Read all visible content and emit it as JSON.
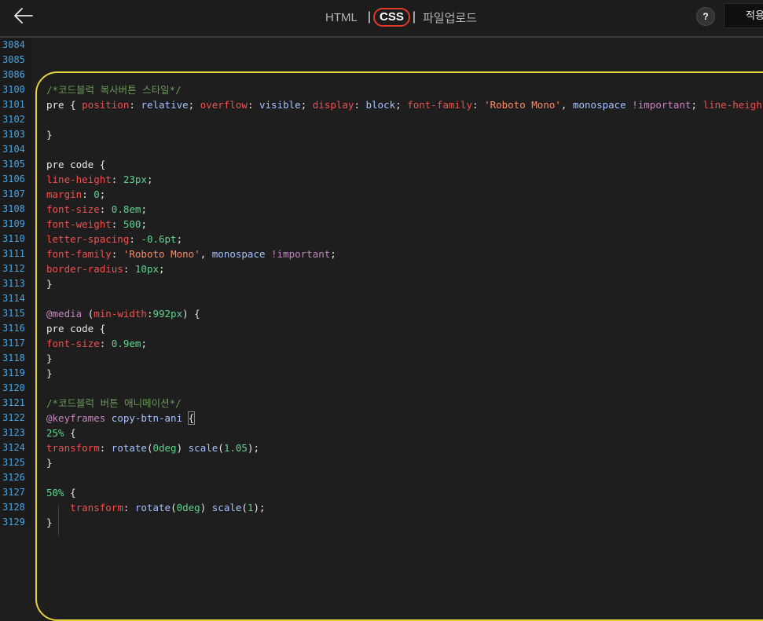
{
  "toolbar": {
    "tabs": {
      "html": "HTML",
      "css": "CSS",
      "upload": "파일업로드"
    },
    "sep": "|",
    "help": "?",
    "apply": "적용"
  },
  "editor": {
    "lines": [
      {
        "n": "3084",
        "t": []
      },
      {
        "n": "3085",
        "t": []
      },
      {
        "n": "3086",
        "t": []
      },
      {
        "n": "3100",
        "t": [
          [
            "com",
            "/*코드블럭 복사버튼 스타일*/"
          ]
        ]
      },
      {
        "n": "3101",
        "t": [
          [
            "sel",
            "pre { "
          ],
          [
            "prop",
            "position"
          ],
          [
            "punct",
            ": "
          ],
          [
            "val",
            "relative"
          ],
          [
            "punct",
            "; "
          ],
          [
            "prop",
            "overflow"
          ],
          [
            "punct",
            ": "
          ],
          [
            "val",
            "visible"
          ],
          [
            "punct",
            "; "
          ],
          [
            "prop",
            "display"
          ],
          [
            "punct",
            ": "
          ],
          [
            "val",
            "block"
          ],
          [
            "punct",
            "; "
          ],
          [
            "prop",
            "font-family"
          ],
          [
            "punct",
            ": "
          ],
          [
            "str",
            "'Roboto Mono'"
          ],
          [
            "punct",
            ", "
          ],
          [
            "val",
            "monospace"
          ],
          [
            "punct",
            " "
          ],
          [
            "imp",
            "!important"
          ],
          [
            "punct",
            "; "
          ],
          [
            "prop",
            "line-height"
          ]
        ]
      },
      {
        "n": "3102",
        "t": []
      },
      {
        "n": "3103",
        "t": [
          [
            "sel",
            "}"
          ]
        ]
      },
      {
        "n": "3104",
        "t": []
      },
      {
        "n": "3105",
        "t": [
          [
            "sel",
            "pre code {"
          ]
        ]
      },
      {
        "n": "3106",
        "t": [
          [
            "prop",
            "line-height"
          ],
          [
            "punct",
            ": "
          ],
          [
            "num",
            "23px"
          ],
          [
            "punct",
            ";"
          ]
        ]
      },
      {
        "n": "3107",
        "t": [
          [
            "prop",
            "margin"
          ],
          [
            "punct",
            ": "
          ],
          [
            "num",
            "0"
          ],
          [
            "punct",
            ";"
          ]
        ]
      },
      {
        "n": "3108",
        "t": [
          [
            "prop",
            "font-size"
          ],
          [
            "punct",
            ": "
          ],
          [
            "num",
            "0.8em"
          ],
          [
            "punct",
            ";"
          ]
        ]
      },
      {
        "n": "3109",
        "t": [
          [
            "prop",
            "font-weight"
          ],
          [
            "punct",
            ": "
          ],
          [
            "num",
            "500"
          ],
          [
            "punct",
            ";"
          ]
        ]
      },
      {
        "n": "3110",
        "t": [
          [
            "prop",
            "letter-spacing"
          ],
          [
            "punct",
            ": "
          ],
          [
            "num",
            "-0.6pt"
          ],
          [
            "punct",
            ";"
          ]
        ]
      },
      {
        "n": "3111",
        "t": [
          [
            "prop",
            "font-family"
          ],
          [
            "punct",
            ": "
          ],
          [
            "str",
            "'Roboto Mono'"
          ],
          [
            "punct",
            ", "
          ],
          [
            "val",
            "monospace"
          ],
          [
            "punct",
            " "
          ],
          [
            "imp",
            "!important"
          ],
          [
            "punct",
            ";"
          ]
        ]
      },
      {
        "n": "3112",
        "t": [
          [
            "prop",
            "border-radius"
          ],
          [
            "punct",
            ": "
          ],
          [
            "num",
            "10px"
          ],
          [
            "punct",
            ";"
          ]
        ]
      },
      {
        "n": "3113",
        "t": [
          [
            "sel",
            "}"
          ]
        ]
      },
      {
        "n": "3114",
        "t": []
      },
      {
        "n": "3115",
        "t": [
          [
            "kw",
            "@media"
          ],
          [
            "punct",
            " ("
          ],
          [
            "prop",
            "min-width"
          ],
          [
            "punct",
            ":"
          ],
          [
            "num",
            "992px"
          ],
          [
            "punct",
            ") {"
          ]
        ]
      },
      {
        "n": "3116",
        "t": [
          [
            "sel",
            "pre code {"
          ]
        ]
      },
      {
        "n": "3117",
        "t": [
          [
            "prop",
            "font-size"
          ],
          [
            "punct",
            ": "
          ],
          [
            "num",
            "0.9em"
          ],
          [
            "punct",
            ";"
          ]
        ]
      },
      {
        "n": "3118",
        "t": [
          [
            "sel",
            "}"
          ]
        ]
      },
      {
        "n": "3119",
        "t": [
          [
            "sel",
            "}"
          ]
        ]
      },
      {
        "n": "3120",
        "t": []
      },
      {
        "n": "3121",
        "t": [
          [
            "com",
            "/*코드블럭 버튼 애니메이션*/"
          ]
        ]
      },
      {
        "n": "3122",
        "t": [
          [
            "kw",
            "@keyframes"
          ],
          [
            "punct",
            " "
          ],
          [
            "val",
            "copy-btn-ani"
          ],
          [
            "punct",
            " "
          ],
          [
            "box",
            "{"
          ]
        ]
      },
      {
        "n": "3123",
        "t": [
          [
            "num",
            "25%"
          ],
          [
            "punct",
            " {"
          ]
        ]
      },
      {
        "n": "3124",
        "t": [
          [
            "prop",
            "transform"
          ],
          [
            "punct",
            ": "
          ],
          [
            "fn",
            "rotate"
          ],
          [
            "punct",
            "("
          ],
          [
            "num",
            "0deg"
          ],
          [
            "punct",
            ") "
          ],
          [
            "fn",
            "scale"
          ],
          [
            "punct",
            "("
          ],
          [
            "num",
            "1.05"
          ],
          [
            "punct",
            ");"
          ]
        ]
      },
      {
        "n": "3125",
        "t": [
          [
            "sel",
            "}"
          ]
        ]
      },
      {
        "n": "3126",
        "t": []
      },
      {
        "n": "3127",
        "t": [
          [
            "num",
            "50%"
          ],
          [
            "punct",
            " {"
          ]
        ]
      },
      {
        "n": "3128",
        "t": [
          [
            "punct",
            "    "
          ],
          [
            "prop",
            "transform"
          ],
          [
            "punct",
            ": "
          ],
          [
            "fn",
            "rotate"
          ],
          [
            "punct",
            "("
          ],
          [
            "num",
            "0deg"
          ],
          [
            "punct",
            ") "
          ],
          [
            "fn",
            "scale"
          ],
          [
            "punct",
            "("
          ],
          [
            "num",
            "1"
          ],
          [
            "punct",
            ");"
          ]
        ]
      },
      {
        "n": "3129",
        "t": [
          [
            "sel",
            "}"
          ]
        ]
      }
    ]
  }
}
